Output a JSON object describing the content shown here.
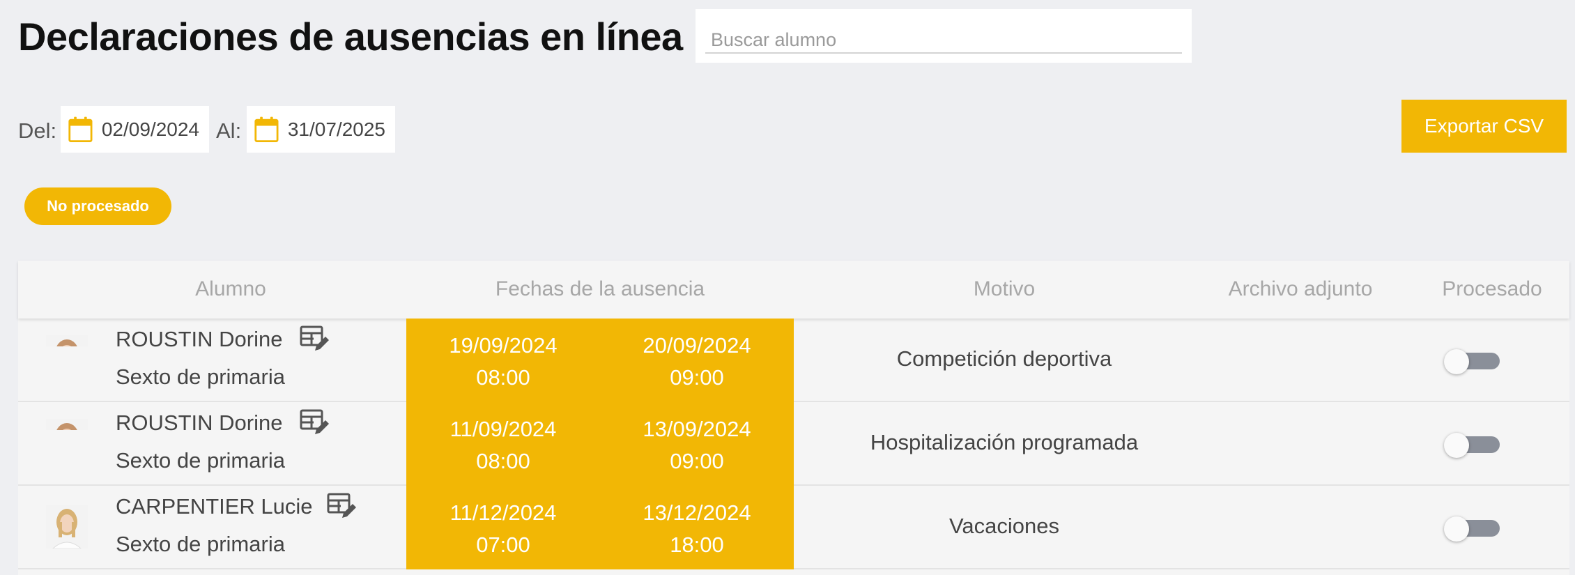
{
  "header": {
    "title": "Declaraciones de ausencias en línea",
    "search_placeholder": "Buscar alumno"
  },
  "date_filter": {
    "from_label": "Del:",
    "from_value": "02/09/2024",
    "to_label": "Al:",
    "to_value": "31/07/2025"
  },
  "export_button": "Exportar CSV",
  "status_filter": "No procesado",
  "table": {
    "columns": [
      "Alumno",
      "Fechas de la ausencia",
      "Motivo",
      "Archivo adjunto",
      "Procesado"
    ],
    "rows": [
      {
        "name": "ROUSTIN Dorine",
        "class": "Sexto de primaria",
        "start_date": "19/09/2024",
        "start_time": "08:00",
        "end_date": "20/09/2024",
        "end_time": "09:00",
        "reason": "Competición deportiva",
        "attachment": "",
        "processed": false
      },
      {
        "name": "ROUSTIN Dorine",
        "class": "Sexto de primaria",
        "start_date": "11/09/2024",
        "start_time": "08:00",
        "end_date": "13/09/2024",
        "end_time": "09:00",
        "reason": "Hospitalización programada",
        "attachment": "",
        "processed": false
      },
      {
        "name": "CARPENTIER Lucie",
        "class": "Sexto de primaria",
        "start_date": "11/12/2024",
        "start_time": "07:00",
        "end_date": "13/12/2024",
        "end_time": "18:00",
        "reason": "Vacaciones",
        "attachment": "",
        "processed": false
      }
    ]
  },
  "colors": {
    "accent": "#f2b705",
    "background": "#eeeff2",
    "toggle_off": "#8a8f99"
  },
  "icons": [
    "calendar-icon",
    "edit-record-icon"
  ]
}
